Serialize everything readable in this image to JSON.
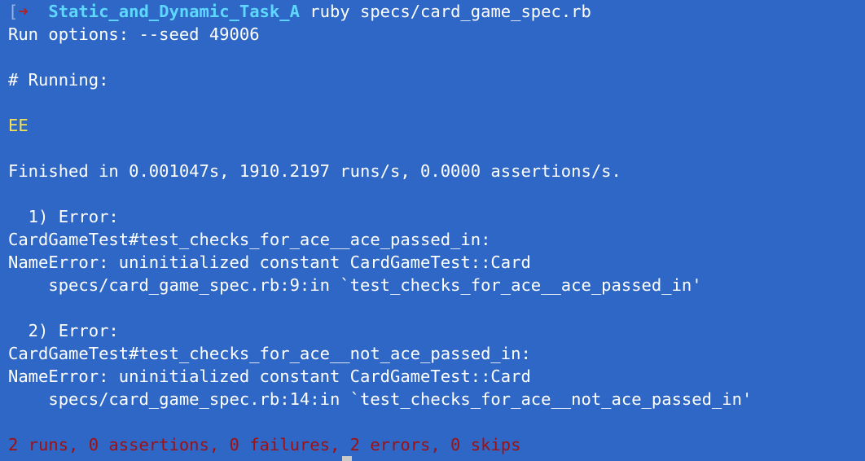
{
  "prompt": {
    "bracket": "[",
    "arrow": "➜",
    "directory": "Static_and_Dynamic_Task_A",
    "command": "ruby specs/card_game_spec.rb"
  },
  "output": {
    "run_options": "Run options: --seed 49006",
    "running": "# Running:",
    "progress": "EE",
    "finished": "Finished in 0.001047s, 1910.2197 runs/s, 0.0000 assertions/s.",
    "errors": [
      {
        "header": "  1) Error:",
        "test": "CardGameTest#test_checks_for_ace__ace_passed_in:",
        "message": "NameError: uninitialized constant CardGameTest::Card",
        "trace": "    specs/card_game_spec.rb:9:in `test_checks_for_ace__ace_passed_in'"
      },
      {
        "header": "  2) Error:",
        "test": "CardGameTest#test_checks_for_ace__not_ace_passed_in:",
        "message": "NameError: uninitialized constant CardGameTest::Card",
        "trace": "    specs/card_game_spec.rb:14:in `test_checks_for_ace__not_ace_passed_in'"
      }
    ],
    "summary": "2 runs, 0 assertions, 0 failures, 2 errors, 0 skips"
  },
  "colors": {
    "background": "#2e67c5",
    "text": "#ffffff",
    "directory": "#5fd7ff",
    "arrow": "#b22222",
    "progress": "#f3e05a",
    "summary": "#a01010"
  }
}
